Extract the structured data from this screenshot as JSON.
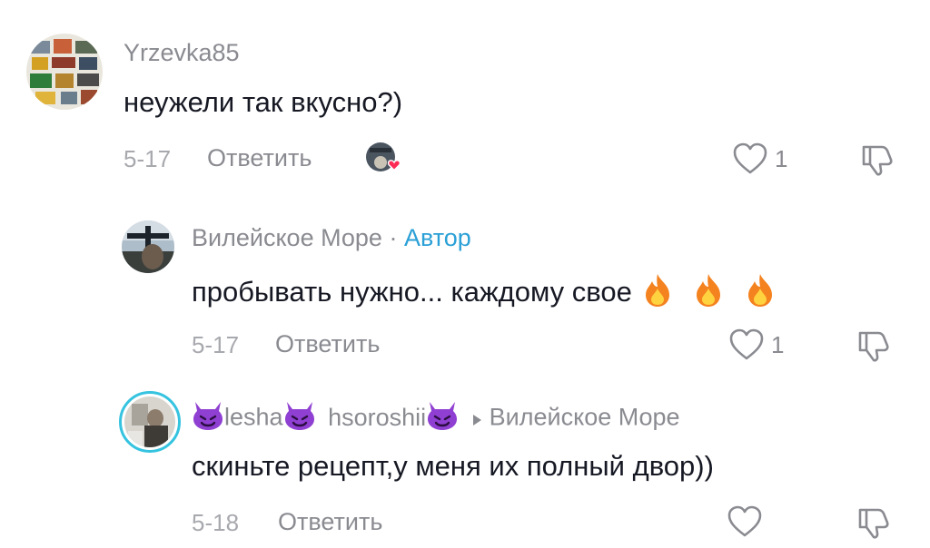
{
  "comments": [
    {
      "username": "Yrzevka85",
      "text": "неужели так вкусно?)",
      "date": "5-17",
      "reply_label": "Ответить",
      "likes": "1"
    },
    {
      "username": "Вилейское Море",
      "separator": "·",
      "author_tag": "Автор",
      "text": "пробывать нужно... каждому свое",
      "date": "5-17",
      "reply_label": "Ответить",
      "likes": "1"
    },
    {
      "username_part1": "lesha",
      "username_part2": "hsoroshii",
      "reply_to": "Вилейское Море",
      "text": "скиньте рецепт,у меня их полный двор))",
      "date": "5-18",
      "reply_label": "Ответить"
    }
  ],
  "icons": {
    "like": "heart-outline-icon",
    "dislike": "thumbs-down-outline-icon",
    "emoji_fire": "fire-emoji",
    "emoji_devil": "smiling-devil-emoji",
    "creator_liked": "creator-liked-badge"
  },
  "colors": {
    "author_tag": "#2ba0d6",
    "avatar_ring": "#35c3e0",
    "heart_badge": "#fe2c55"
  }
}
